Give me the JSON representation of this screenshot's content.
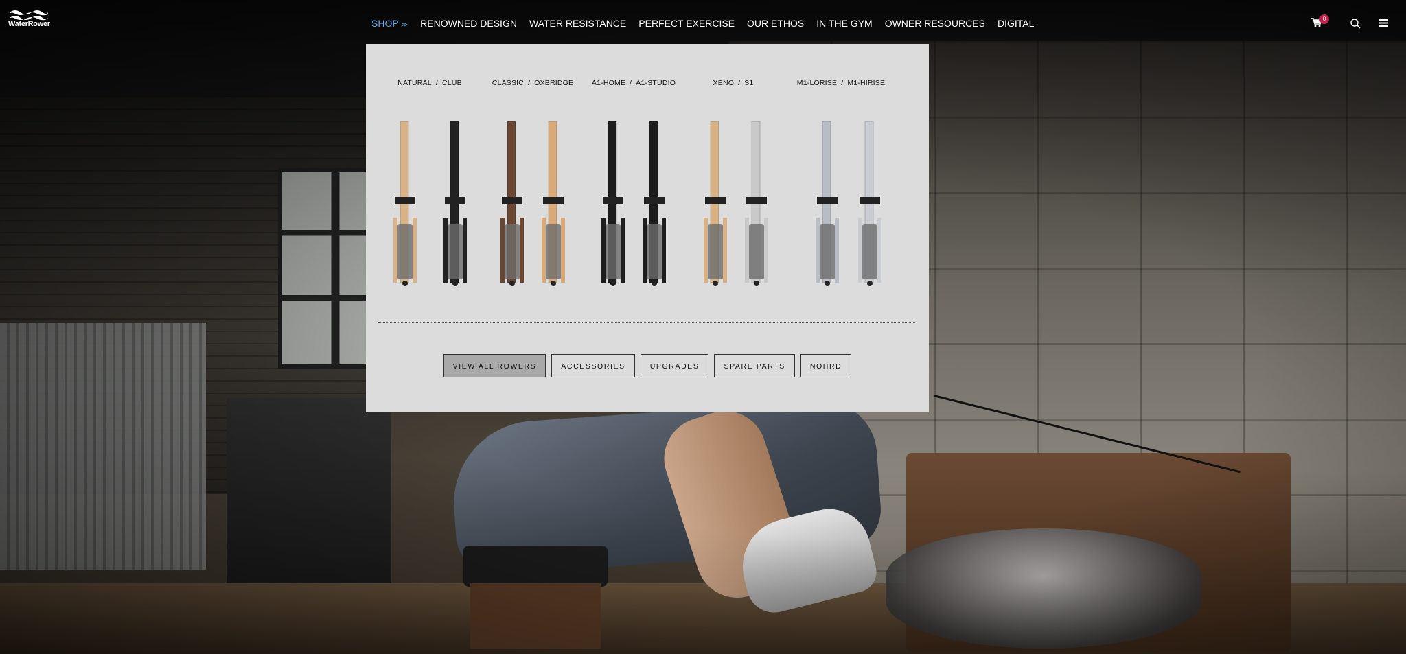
{
  "brand": {
    "logo_text": "WaterRower"
  },
  "nav": {
    "items": [
      {
        "label": "SHOP",
        "active": true
      },
      {
        "label": "RENOWNED DESIGN"
      },
      {
        "label": "WATER RESISTANCE"
      },
      {
        "label": "PERFECT EXERCISE"
      },
      {
        "label": "OUR ETHOS"
      },
      {
        "label": "IN THE GYM"
      },
      {
        "label": "OWNER RESOURCES"
      },
      {
        "label": "DIGITAL"
      }
    ],
    "shop_caret": "≫"
  },
  "header_icons": {
    "cart": "cart-icon",
    "cart_count": "0",
    "search": "search-icon",
    "menu": "hamburger-icon"
  },
  "mega_menu": {
    "columns": [
      {
        "left": "NATURAL",
        "right": "CLUB",
        "colors": [
          "#d7b387",
          "#222222"
        ]
      },
      {
        "left": "CLASSIC",
        "right": "OXBRIDGE",
        "colors": [
          "#6a4630",
          "#d9aa78"
        ]
      },
      {
        "left": "A1-HOME",
        "right": "A1-STUDIO",
        "colors": [
          "#1d1d1d",
          "#1d1d1d"
        ]
      },
      {
        "left": "XENO",
        "right": "S1",
        "colors": [
          "#d8b283",
          "#c9c9c9"
        ]
      },
      {
        "left": "M1-LORISE",
        "right": "M1-HIRISE",
        "colors": [
          "#b8bcc4",
          "#c9ccd1"
        ]
      }
    ],
    "separator": "/",
    "buttons": [
      {
        "label": "VIEW ALL ROWERS",
        "primary": true
      },
      {
        "label": "ACCESSORIES"
      },
      {
        "label": "UPGRADES"
      },
      {
        "label": "SPARE PARTS"
      },
      {
        "label": "NOHRD"
      }
    ]
  },
  "colors": {
    "active_nav": "#5aa7e8",
    "badge": "#c0224a",
    "menu_bg": "#dcdcdc"
  }
}
